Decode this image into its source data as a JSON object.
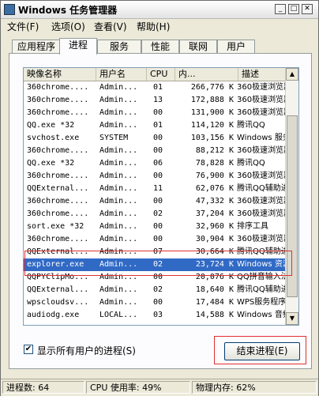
{
  "window": {
    "title": "Windows 任务管理器"
  },
  "menu": [
    "文件(F)",
    "选项(O)",
    "查看(V)",
    "帮助(H)"
  ],
  "tabs": [
    "应用程序",
    "进程",
    "服务",
    "性能",
    "联网",
    "用户"
  ],
  "active_tab": "进程",
  "columns": [
    "映像名称",
    "用户名",
    "CPU",
    "内...",
    "描述"
  ],
  "rows": [
    [
      "360chrome....",
      "Admin...",
      "01",
      "266,776 K",
      "360极速浏览器"
    ],
    [
      "360chrome....",
      "Admin...",
      "13",
      "172,888 K",
      "360极速浏览器"
    ],
    [
      "360chrome....",
      "Admin...",
      "00",
      "131,900 K",
      "360极速浏览器"
    ],
    [
      "QQ.exe *32",
      "Admin...",
      "01",
      "114,120 K",
      "腾讯QQ"
    ],
    [
      "svchost.exe",
      "SYSTEM",
      "00",
      "103,156 K",
      "Windows 服务"
    ],
    [
      "360chrome....",
      "Admin...",
      "00",
      "88,212 K",
      "360极速浏览器"
    ],
    [
      "QQ.exe *32",
      "Admin...",
      "06",
      "78,828 K",
      "腾讯QQ"
    ],
    [
      "360chrome....",
      "Admin...",
      "00",
      "76,900 K",
      "360极速浏览器"
    ],
    [
      "QQExternal...",
      "Admin...",
      "11",
      "62,076 K",
      "腾讯QQ辅助进程"
    ],
    [
      "360chrome....",
      "Admin...",
      "00",
      "47,332 K",
      "360极速浏览器"
    ],
    [
      "360chrome....",
      "Admin...",
      "02",
      "37,204 K",
      "360极速浏览器"
    ],
    [
      "sort.exe *32",
      "Admin...",
      "00",
      "32,960 K",
      "排序工具"
    ],
    [
      "360chrome....",
      "Admin...",
      "00",
      "30,904 K",
      "360极速浏览器"
    ],
    [
      "QQExternal...",
      "Admin...",
      "07",
      "30,664 K",
      "腾讯QQ辅助进程"
    ],
    [
      "explorer.exe",
      "Admin...",
      "02",
      "23,724 K",
      "Windows 资源"
    ],
    [
      "QQPYClipMo...",
      "Admin...",
      "00",
      "20,076 K",
      "QQ拼音输入法"
    ],
    [
      "QQExternal...",
      "Admin...",
      "02",
      "18,640 K",
      "腾讯QQ辅助进程"
    ],
    [
      "wpscloudsv...",
      "Admin...",
      "00",
      "17,484 K",
      "WPS服务程序"
    ],
    [
      "audiodg.exe",
      "LOCAL...",
      "03",
      "14,588 K",
      "Windows 音频"
    ]
  ],
  "selected_row": 14,
  "show_all_users_label": "显示所有用户的进程(S)",
  "show_all_users_checked": true,
  "end_process_label": "结束进程(E)",
  "status": {
    "processes": "进程数: 64",
    "cpu": "CPU 使用率: 49%",
    "memory": "物理内存: 62%"
  },
  "icons": {
    "checkmark": "✔",
    "scroll_up": "▲",
    "scroll_down": "▼",
    "minimize": "_",
    "maximize": "□",
    "close": "✕"
  }
}
